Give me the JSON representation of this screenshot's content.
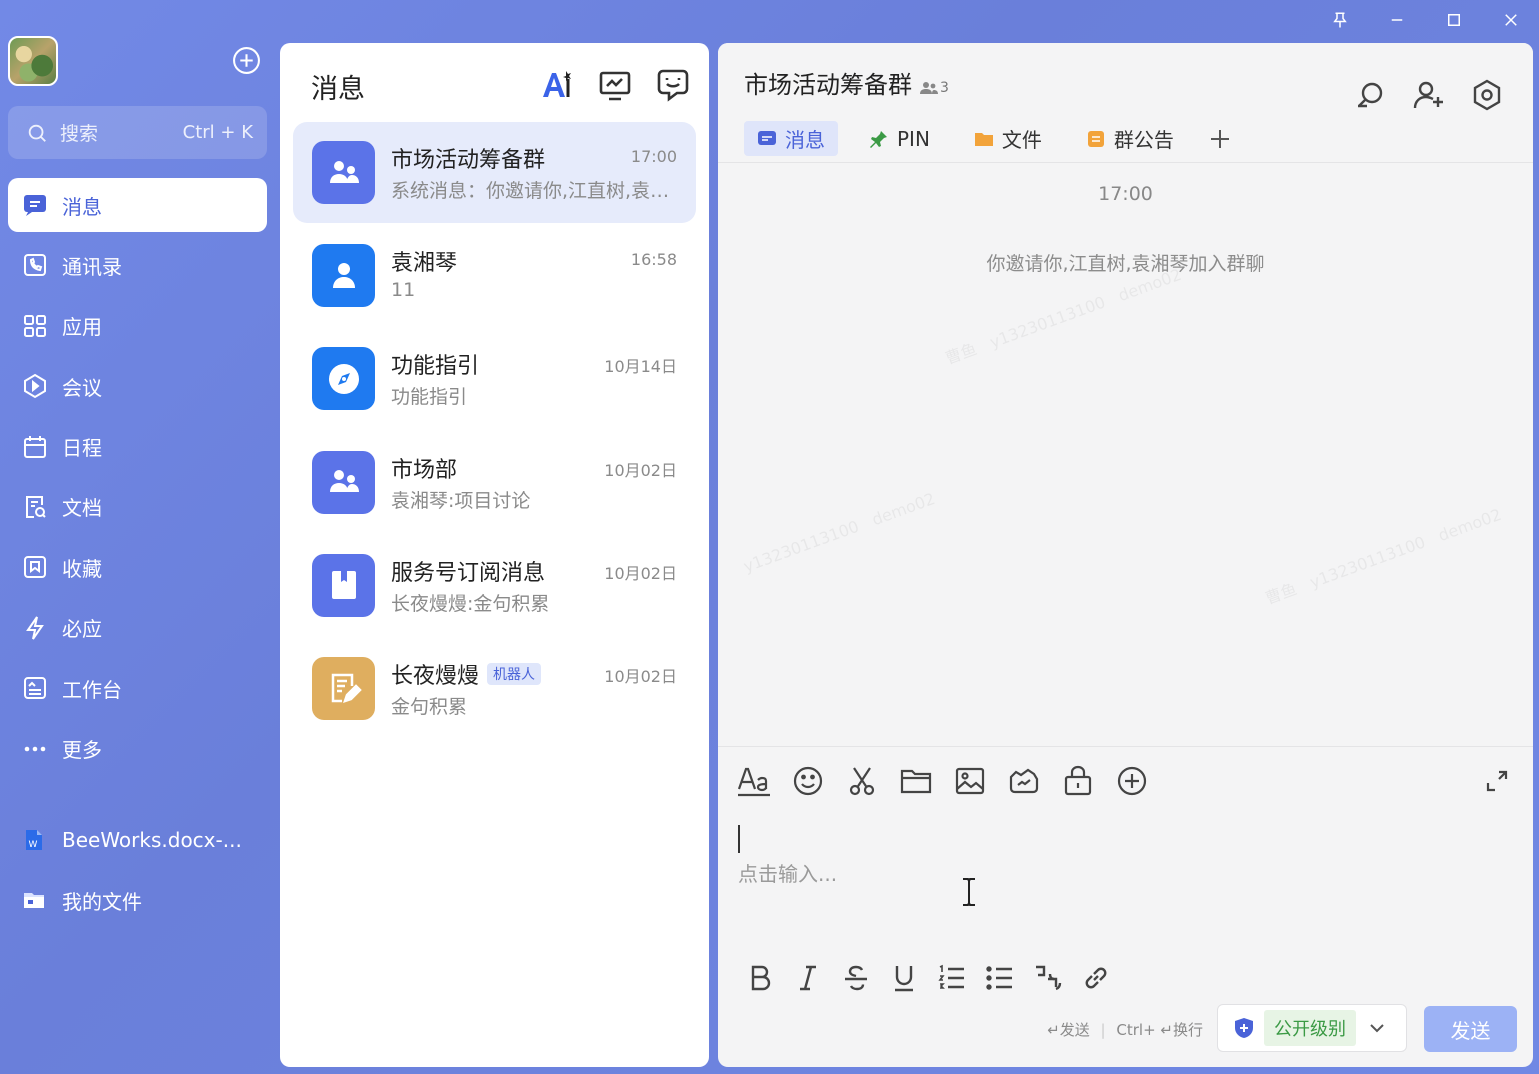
{
  "window": {
    "pin_icon": "pin-icon",
    "minimize_icon": "minimize-icon",
    "maximize_icon": "maximize-icon",
    "close_icon": "close-icon"
  },
  "sidebar": {
    "search_placeholder": "搜索",
    "search_shortcut": "Ctrl + K",
    "items": [
      {
        "label": "消息",
        "icon": "message-icon",
        "active": true
      },
      {
        "label": "通讯录",
        "icon": "contacts-icon"
      },
      {
        "label": "应用",
        "icon": "apps-icon"
      },
      {
        "label": "会议",
        "icon": "meeting-icon"
      },
      {
        "label": "日程",
        "icon": "calendar-icon"
      },
      {
        "label": "文档",
        "icon": "docs-icon"
      },
      {
        "label": "收藏",
        "icon": "favorites-icon"
      },
      {
        "label": "必应",
        "icon": "lightning-icon"
      },
      {
        "label": "工作台",
        "icon": "workbench-icon"
      },
      {
        "label": "更多",
        "icon": "more-icon"
      }
    ],
    "files": [
      {
        "label": "BeeWorks.docx-...",
        "icon": "word-doc-icon"
      },
      {
        "label": "我的文件",
        "icon": "folder-icon"
      }
    ]
  },
  "conversations": {
    "title": "消息",
    "items": [
      {
        "name": "市场活动筹备群",
        "time": "17:00",
        "preview": "系统消息：你邀请你,江直树,袁湘琴加入群聊",
        "avatar": "group-icon",
        "color": "#5b73e8"
      },
      {
        "name": "袁湘琴",
        "time": "16:58",
        "preview": "11",
        "avatar": "person-icon",
        "color": "#1f7af0"
      },
      {
        "name": "功能指引",
        "time": "10月14日",
        "preview": "功能指引",
        "avatar": "compass-icon",
        "color": "#1f7af0"
      },
      {
        "name": "市场部",
        "time": "10月02日",
        "preview": "袁湘琴:项目讨论",
        "avatar": "group-icon",
        "color": "#5b73e8"
      },
      {
        "name": "服务号订阅消息",
        "time": "10月02日",
        "preview": "长夜熳熳:金句积累",
        "avatar": "bookmark-icon",
        "color": "#5b73e8"
      },
      {
        "name": "长夜熳熳",
        "tag": "机器人",
        "time": "10月02日",
        "preview": "金句积累",
        "avatar": "note-icon",
        "color": "#dfae5f"
      }
    ]
  },
  "chat": {
    "title": "市场活动筹备群",
    "member_count": "3",
    "tabs": [
      {
        "label": "消息",
        "active": true,
        "color": "#4a63d8"
      },
      {
        "label": "PIN",
        "color": "#3b9a45"
      },
      {
        "label": "文件",
        "color": "#f2a33a"
      },
      {
        "label": "群公告",
        "color": "#f2a33a"
      }
    ],
    "time": "17:00",
    "system_message": "你邀请你,江直树,袁湘琴加入群聊",
    "input_placeholder": "点击输入...",
    "hint_send": "↵发送",
    "hint_newline": "Ctrl+ ↵换行",
    "level_label": "公开级别",
    "send_label": "发送"
  }
}
